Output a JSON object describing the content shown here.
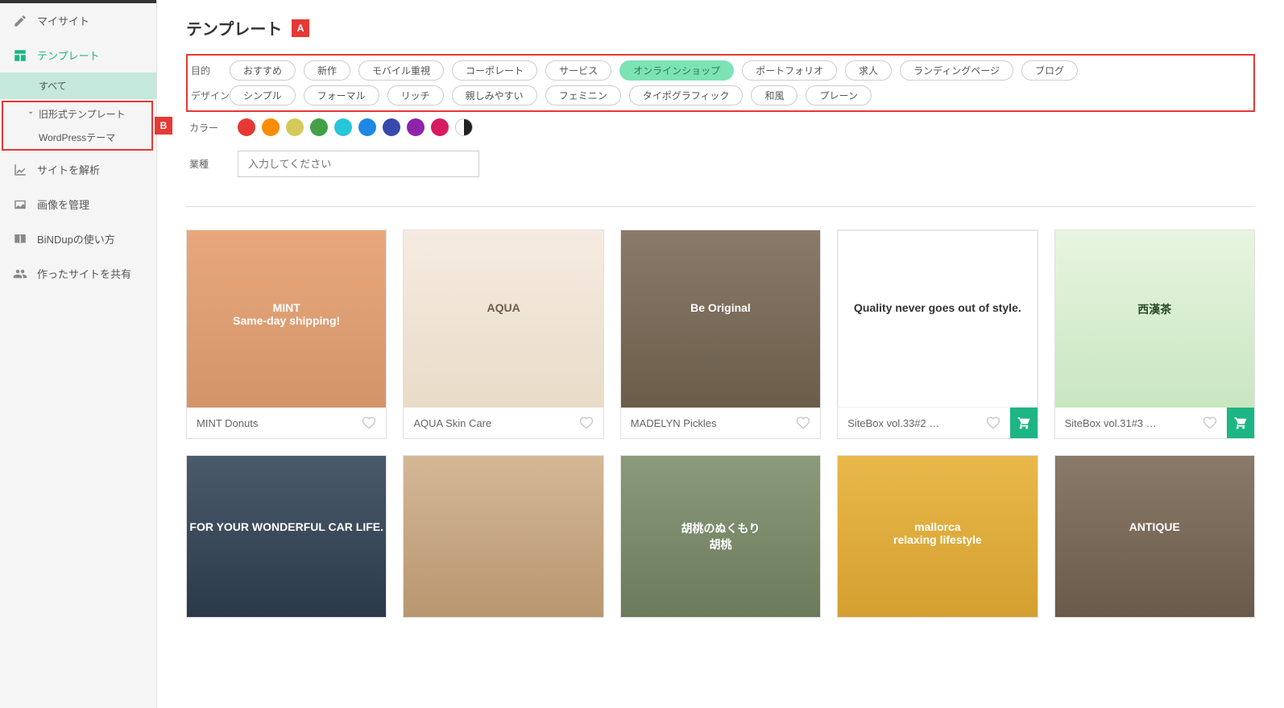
{
  "sidebar": {
    "mysite": "マイサイト",
    "template": "テンプレート",
    "sub_all": "すべて",
    "sub_old": "旧形式テンプレート",
    "sub_wp": "WordPressテーマ",
    "analytics": "サイトを解析",
    "images": "画像を管理",
    "howto": "BiNDupの使い方",
    "share": "作ったサイトを共有"
  },
  "annotations": {
    "a": "A",
    "b": "B"
  },
  "page": {
    "title": "テンプレート"
  },
  "filters": {
    "purpose_label": "目的",
    "design_label": "デザイン",
    "color_label": "カラー",
    "industry_label": "業種",
    "industry_placeholder": "入力してください",
    "purpose": [
      "おすすめ",
      "新作",
      "モバイル重視",
      "コーポレート",
      "サービス",
      "オンラインショップ",
      "ポートフォリオ",
      "求人",
      "ランディングページ",
      "ブログ"
    ],
    "purpose_active": "オンラインショップ",
    "design": [
      "シンプル",
      "フォーマル",
      "リッチ",
      "親しみやすい",
      "フェミニン",
      "タイポグラフィック",
      "和風",
      "プレーン"
    ],
    "colors": [
      "#e53935",
      "#fb8c00",
      "#d4c95a",
      "#43a047",
      "#26c6da",
      "#1e88e5",
      "#3949ab",
      "#8e24aa",
      "#d81b60",
      "half"
    ]
  },
  "templates": [
    {
      "title": "MINT Donuts",
      "cart": false,
      "thumb": {
        "bg": "linear-gradient(#e8a87c,#d4946a)",
        "text": "MINT\nSame-day shipping!",
        "textColor": "#fff"
      }
    },
    {
      "title": "AQUA Skin Care",
      "cart": false,
      "thumb": {
        "bg": "linear-gradient(#f5ebe0,#e8dcc8)",
        "text": "AQUA",
        "textColor": "#6b5d4a"
      }
    },
    {
      "title": "MADELYN Pickles",
      "cart": false,
      "thumb": {
        "bg": "linear-gradient(#8a7a6a,#6b5d4a)",
        "text": "Be Original",
        "textColor": "#fff"
      }
    },
    {
      "title": "SiteBox vol.33#2 …",
      "cart": true,
      "thumb": {
        "bg": "#ffffff",
        "text": "Quality never goes out of style.",
        "textColor": "#333",
        "border": true
      }
    },
    {
      "title": "SiteBox vol.31#3 …",
      "cart": true,
      "thumb": {
        "bg": "linear-gradient(#e8f5e0,#c8e6c0)",
        "text": "西漢茶",
        "textColor": "#2a4a2a"
      }
    }
  ],
  "templates_row2": [
    {
      "thumb": {
        "bg": "linear-gradient(#4a5a6a,#2a3a4a)",
        "text": "FOR YOUR WONDERFUL CAR LIFE.",
        "textColor": "#fff"
      }
    },
    {
      "thumb": {
        "bg": "linear-gradient(#d4b896,#b89670)",
        "text": "",
        "textColor": "#fff"
      }
    },
    {
      "thumb": {
        "bg": "linear-gradient(#8a9a7a,#6a7a5a)",
        "text": "胡桃のぬくもり\n胡桃",
        "textColor": "#fff"
      }
    },
    {
      "thumb": {
        "bg": "linear-gradient(#e8b84a,#d4a030)",
        "text": "mallorca\nrelaxing lifestyle",
        "textColor": "#fff"
      }
    },
    {
      "thumb": {
        "bg": "linear-gradient(#8a7a6a,#6a5a4a)",
        "text": "ANTIQUE",
        "textColor": "#fff"
      }
    }
  ]
}
